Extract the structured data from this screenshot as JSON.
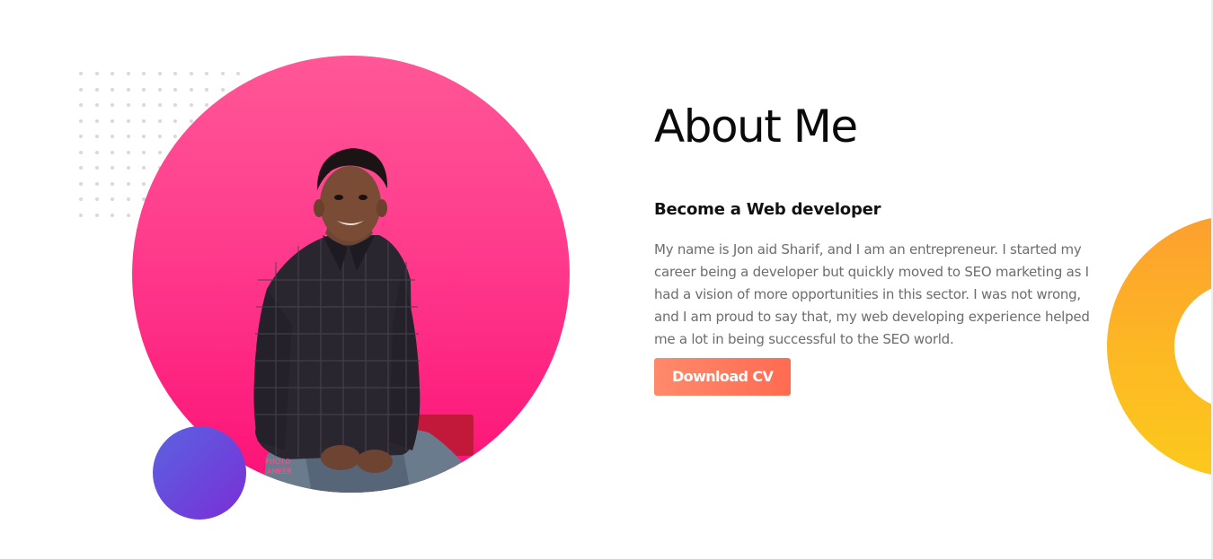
{
  "about": {
    "title": "About Me",
    "subtitle": "Become a Web developer",
    "bio_lines": [
      "My name is Jon aid Sharif, and I am an entrepreneur. I started my",
      "career being a developer but quickly moved to SEO marketing as I",
      "had a vision of more opportunities in this sector. I was not wrong,",
      "and I am proud to say that, my web developing experience helped",
      "me a lot in being successful to the SEO world."
    ],
    "download_label": "Download CV"
  },
  "colors": {
    "pink_top": "#ff5797",
    "pink_bottom": "#fc1176",
    "blue": "#6a48dc",
    "orange": "#fdbb22",
    "button": "#ff6b51"
  }
}
